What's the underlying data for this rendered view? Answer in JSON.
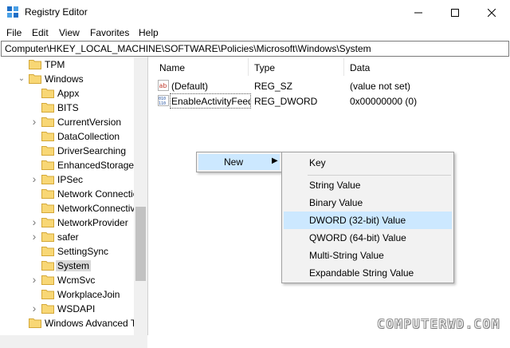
{
  "window": {
    "title": "Registry Editor",
    "minimize_icon": "minimize-icon",
    "maximize_icon": "maximize-icon",
    "close_icon": "close-icon"
  },
  "menu": [
    "File",
    "Edit",
    "View",
    "Favorites",
    "Help"
  ],
  "address": "Computer\\HKEY_LOCAL_MACHINE\\SOFTWARE\\Policies\\Microsoft\\Windows\\System",
  "tree": {
    "items": [
      {
        "label": "TPM",
        "expand": ""
      },
      {
        "label": "Windows",
        "expand": "expanded"
      },
      {
        "label": "Appx",
        "expand": ""
      },
      {
        "label": "BITS",
        "expand": ""
      },
      {
        "label": "CurrentVersion",
        "expand": "collapsed"
      },
      {
        "label": "DataCollection",
        "expand": ""
      },
      {
        "label": "DriverSearching",
        "expand": ""
      },
      {
        "label": "EnhancedStorageDevices",
        "expand": ""
      },
      {
        "label": "IPSec",
        "expand": "collapsed"
      },
      {
        "label": "Network Connections",
        "expand": ""
      },
      {
        "label": "NetworkConnectivityStatusIndicator",
        "expand": ""
      },
      {
        "label": "NetworkProvider",
        "expand": "collapsed"
      },
      {
        "label": "safer",
        "expand": "collapsed"
      },
      {
        "label": "SettingSync",
        "expand": ""
      },
      {
        "label": "System",
        "expand": "",
        "selected": true
      },
      {
        "label": "WcmSvc",
        "expand": "collapsed"
      },
      {
        "label": "WorkplaceJoin",
        "expand": ""
      },
      {
        "label": "WSDAPI",
        "expand": "collapsed"
      },
      {
        "label": "Windows Advanced Threat Protection",
        "expand": ""
      }
    ]
  },
  "list": {
    "headers": {
      "name": "Name",
      "type": "Type",
      "data": "Data"
    },
    "rows": [
      {
        "name": "(Default)",
        "type": "REG_SZ",
        "data": "(value not set)",
        "icon": "string-value-icon"
      },
      {
        "name": "EnableActivityFeed",
        "type": "REG_DWORD",
        "data": "0x00000000 (0)",
        "icon": "binary-value-icon"
      }
    ]
  },
  "context_menu": {
    "new_label": "New",
    "submenu": [
      "Key",
      "String Value",
      "Binary Value",
      "DWORD (32-bit) Value",
      "QWORD (64-bit) Value",
      "Multi-String Value",
      "Expandable String Value"
    ],
    "highlighted": "DWORD (32-bit) Value"
  },
  "watermark": "COMPUTERWD.COM",
  "colors": {
    "highlight": "#cce8ff",
    "folder": "#f8d775",
    "selection": "#d9d9d9"
  }
}
